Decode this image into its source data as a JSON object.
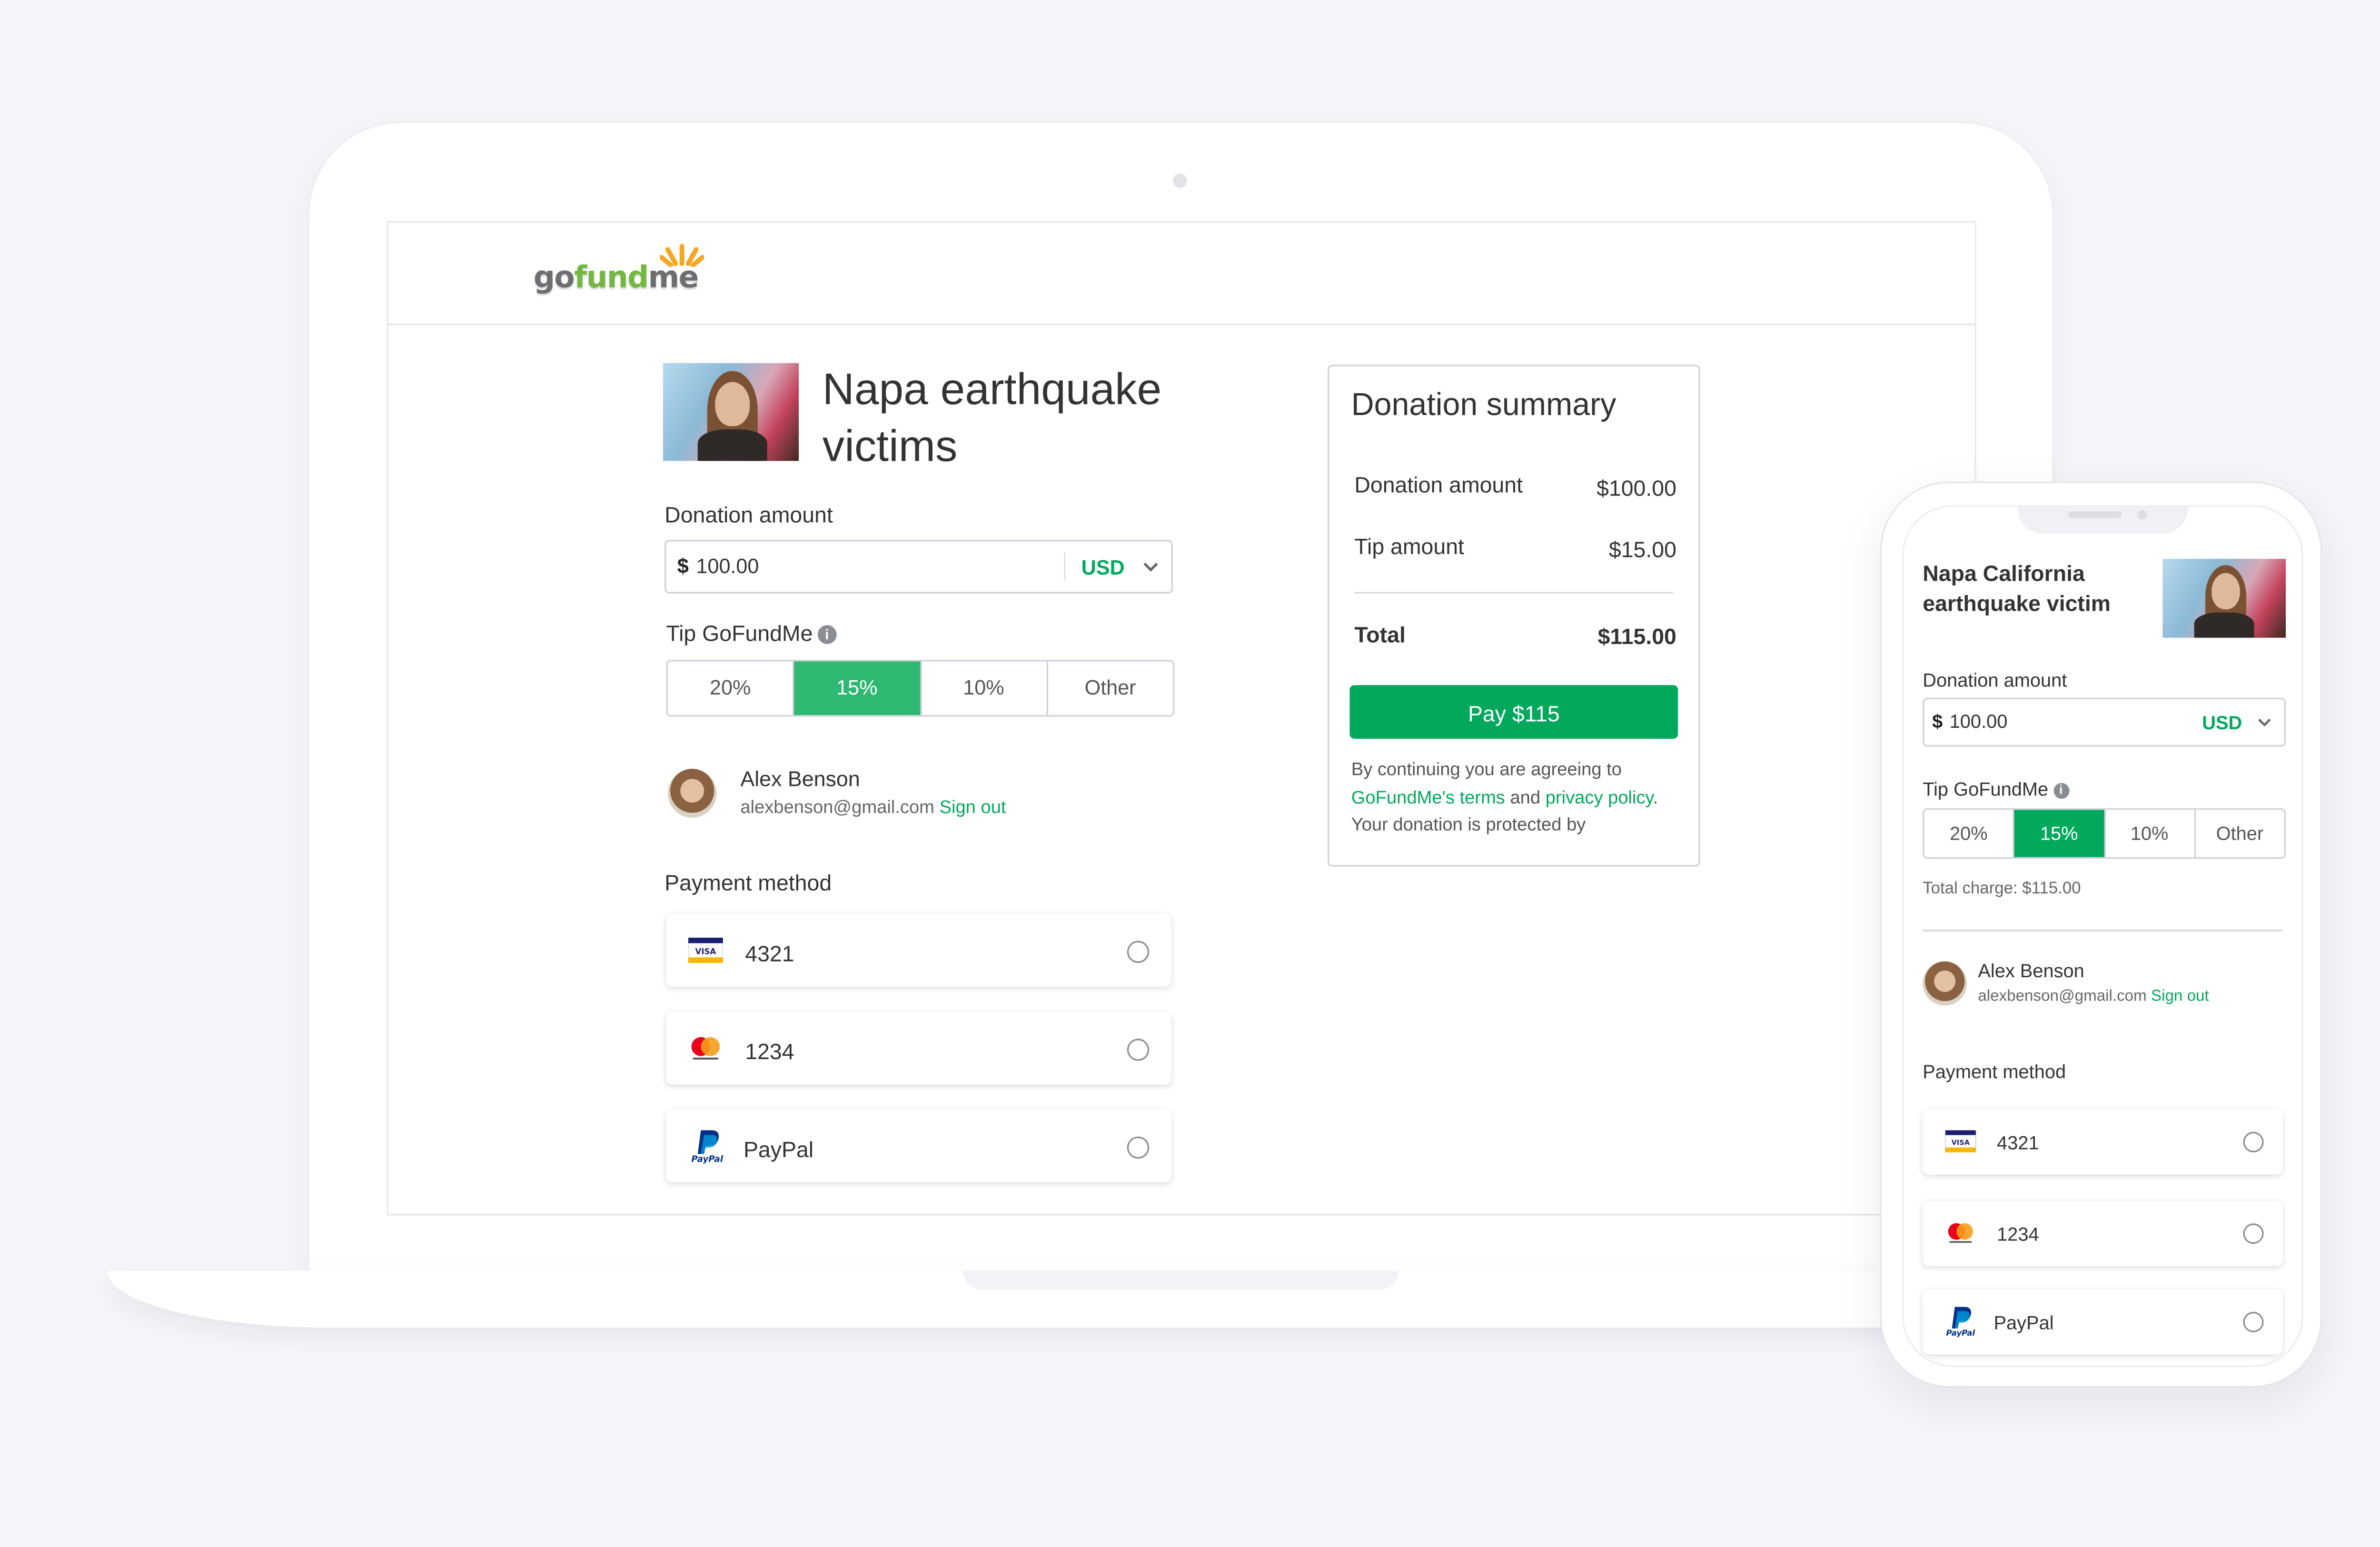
{
  "brand": {
    "logo_text_a": "go",
    "logo_text_b": "fund",
    "logo_text_c": "me",
    "grey": "#6d6e71",
    "green": "#74b843",
    "accent": "#02a95c",
    "sun": "#f5a623"
  },
  "desktop": {
    "campaign_title": "Napa earthquake victims",
    "donation_label": "Donation amount",
    "currency_symbol": "$",
    "amount_value": "100.00",
    "currency": "USD",
    "tip_label": "Tip GoFundMe",
    "tips": [
      "20%",
      "15%",
      "10%",
      "Other"
    ],
    "selected_tip": "15%",
    "user": {
      "name": "Alex Benson",
      "email": "alexbenson@gmail.com",
      "sign_out": "Sign out"
    },
    "payment_label": "Payment method",
    "payments": [
      {
        "icon": "visa-card-icon",
        "label": "4321"
      },
      {
        "icon": "mastercard-icon",
        "label": "1234"
      },
      {
        "icon": "paypal-icon",
        "label": "PayPal"
      }
    ]
  },
  "summary": {
    "title": "Donation summary",
    "rows": [
      {
        "label": "Donation amount",
        "value": "$100.00"
      },
      {
        "label": "Tip amount",
        "value": "$15.00"
      }
    ],
    "total_label": "Total",
    "total_value": "$115.00",
    "pay_button": "Pay $115",
    "terms_pre": "By continuing you are agreeing to",
    "terms_link": "GoFundMe's terms",
    "terms_and": "and",
    "privacy_link": "privacy policy",
    "terms_post": "Your donation is protected by"
  },
  "mobile": {
    "campaign_title": "Napa California earthquake victim",
    "donation_label": "Donation amount",
    "currency_symbol": "$",
    "amount_value": "100.00",
    "currency": "USD",
    "tip_label": "Tip GoFundMe",
    "tips": [
      "20%",
      "15%",
      "10%",
      "Other"
    ],
    "selected_tip": "15%",
    "total_charge": "Total charge: $115.00",
    "user": {
      "name": "Alex Benson",
      "email": "alexbenson@gmail.com",
      "sign_out": "Sign out"
    },
    "payment_label": "Payment method",
    "payments": [
      {
        "icon": "visa-card-icon",
        "label": "4321"
      },
      {
        "icon": "mastercard-icon",
        "label": "1234"
      },
      {
        "icon": "paypal-icon",
        "label": "PayPal"
      }
    ]
  }
}
